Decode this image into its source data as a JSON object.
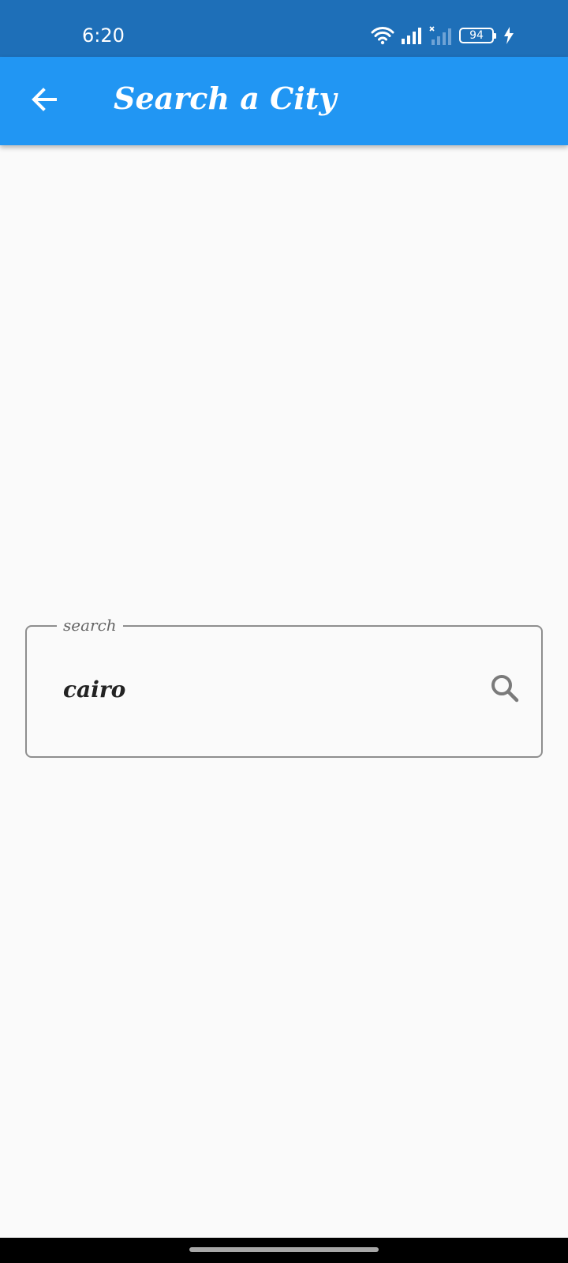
{
  "status_bar": {
    "time": "6:20",
    "battery": "94",
    "icons": [
      "wifi-icon",
      "signal-icon",
      "signal-no-service-icon",
      "battery-icon",
      "charging-icon"
    ]
  },
  "app_bar": {
    "title": "Search a City",
    "back_icon": "arrow-left-icon",
    "color": "#2196f3"
  },
  "search": {
    "label": "search",
    "value": "cairo",
    "icon": "search-icon"
  },
  "colors": {
    "status_bar": "#1e6fb8",
    "app_bar": "#2196f3",
    "background": "#fafafa"
  }
}
